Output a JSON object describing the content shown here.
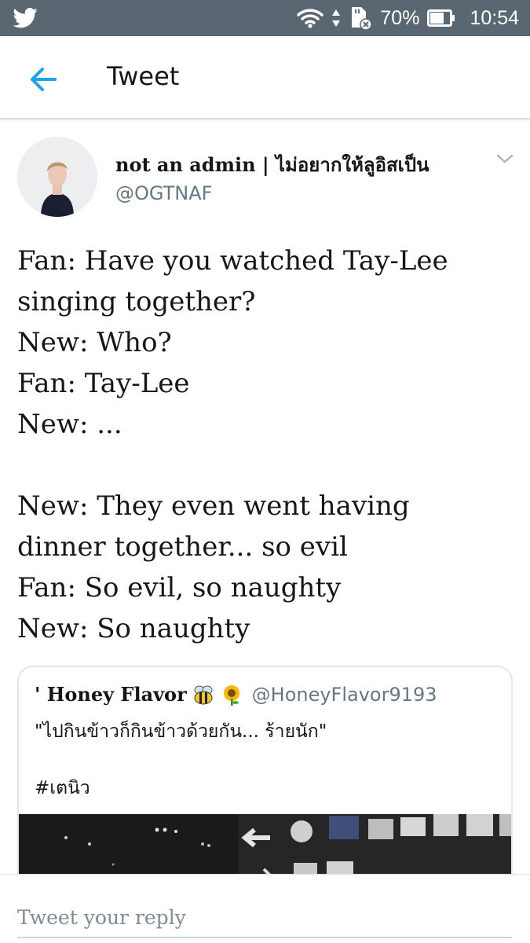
{
  "status_bar": {
    "battery": "70%",
    "time": "10:54",
    "icons": [
      "twitter-bird-icon",
      "wifi-icon",
      "data-arrows-icon",
      "sd-card-icon",
      "battery-icon"
    ]
  },
  "header": {
    "title": "Tweet",
    "back_icon": "arrow-left-icon"
  },
  "tweet": {
    "author_name": "not an admin | ไม่อยากให้ลูอิสเป็น",
    "author_handle": "@OGTNAF",
    "lines": [
      "Fan: Have you watched Tay-Lee",
      "singing together?",
      "New: Who?",
      "Fan: Tay-Lee",
      "New: ...",
      "",
      "New: They even went having",
      "dinner together... so evil",
      "Fan: So evil, so naughty",
      "New: So naughty"
    ]
  },
  "quoted_tweet": {
    "name": "' Honey Flavor",
    "emojis": [
      "bee-emoji",
      "sunflower-emoji"
    ],
    "handle": "@HoneyFlavor9193",
    "text": "\"ไปกินข้าวก็กินข้าวด้วยกัน... ร้ายนัก\"",
    "hashtag": "#เตนิว"
  },
  "reply": {
    "placeholder": "Tweet your reply"
  },
  "colors": {
    "status_bar": "#5a6773",
    "accent": "#1da1f2",
    "secondary_text": "#657786",
    "border": "#e1e8ed"
  }
}
